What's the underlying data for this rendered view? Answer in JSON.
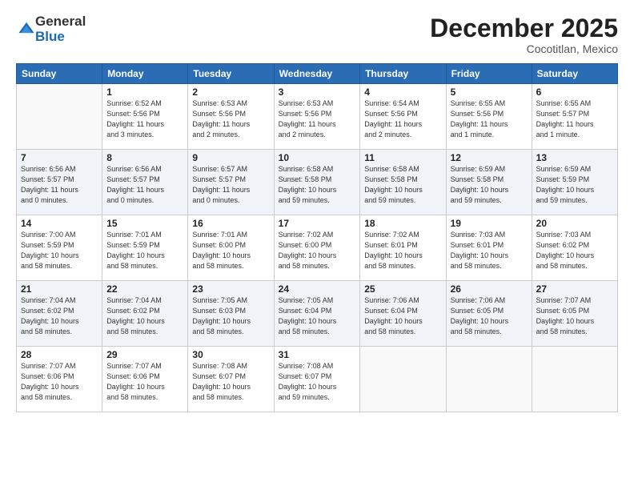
{
  "logo": {
    "general": "General",
    "blue": "Blue"
  },
  "title": "December 2025",
  "subtitle": "Cocotitlan, Mexico",
  "days_header": [
    "Sunday",
    "Monday",
    "Tuesday",
    "Wednesday",
    "Thursday",
    "Friday",
    "Saturday"
  ],
  "weeks": [
    [
      {
        "day": "",
        "info": ""
      },
      {
        "day": "1",
        "info": "Sunrise: 6:52 AM\nSunset: 5:56 PM\nDaylight: 11 hours\nand 3 minutes."
      },
      {
        "day": "2",
        "info": "Sunrise: 6:53 AM\nSunset: 5:56 PM\nDaylight: 11 hours\nand 2 minutes."
      },
      {
        "day": "3",
        "info": "Sunrise: 6:53 AM\nSunset: 5:56 PM\nDaylight: 11 hours\nand 2 minutes."
      },
      {
        "day": "4",
        "info": "Sunrise: 6:54 AM\nSunset: 5:56 PM\nDaylight: 11 hours\nand 2 minutes."
      },
      {
        "day": "5",
        "info": "Sunrise: 6:55 AM\nSunset: 5:56 PM\nDaylight: 11 hours\nand 1 minute."
      },
      {
        "day": "6",
        "info": "Sunrise: 6:55 AM\nSunset: 5:57 PM\nDaylight: 11 hours\nand 1 minute."
      }
    ],
    [
      {
        "day": "7",
        "info": "Sunrise: 6:56 AM\nSunset: 5:57 PM\nDaylight: 11 hours\nand 0 minutes."
      },
      {
        "day": "8",
        "info": "Sunrise: 6:56 AM\nSunset: 5:57 PM\nDaylight: 11 hours\nand 0 minutes."
      },
      {
        "day": "9",
        "info": "Sunrise: 6:57 AM\nSunset: 5:57 PM\nDaylight: 11 hours\nand 0 minutes."
      },
      {
        "day": "10",
        "info": "Sunrise: 6:58 AM\nSunset: 5:58 PM\nDaylight: 10 hours\nand 59 minutes."
      },
      {
        "day": "11",
        "info": "Sunrise: 6:58 AM\nSunset: 5:58 PM\nDaylight: 10 hours\nand 59 minutes."
      },
      {
        "day": "12",
        "info": "Sunrise: 6:59 AM\nSunset: 5:58 PM\nDaylight: 10 hours\nand 59 minutes."
      },
      {
        "day": "13",
        "info": "Sunrise: 6:59 AM\nSunset: 5:59 PM\nDaylight: 10 hours\nand 59 minutes."
      }
    ],
    [
      {
        "day": "14",
        "info": "Sunrise: 7:00 AM\nSunset: 5:59 PM\nDaylight: 10 hours\nand 58 minutes."
      },
      {
        "day": "15",
        "info": "Sunrise: 7:01 AM\nSunset: 5:59 PM\nDaylight: 10 hours\nand 58 minutes."
      },
      {
        "day": "16",
        "info": "Sunrise: 7:01 AM\nSunset: 6:00 PM\nDaylight: 10 hours\nand 58 minutes."
      },
      {
        "day": "17",
        "info": "Sunrise: 7:02 AM\nSunset: 6:00 PM\nDaylight: 10 hours\nand 58 minutes."
      },
      {
        "day": "18",
        "info": "Sunrise: 7:02 AM\nSunset: 6:01 PM\nDaylight: 10 hours\nand 58 minutes."
      },
      {
        "day": "19",
        "info": "Sunrise: 7:03 AM\nSunset: 6:01 PM\nDaylight: 10 hours\nand 58 minutes."
      },
      {
        "day": "20",
        "info": "Sunrise: 7:03 AM\nSunset: 6:02 PM\nDaylight: 10 hours\nand 58 minutes."
      }
    ],
    [
      {
        "day": "21",
        "info": "Sunrise: 7:04 AM\nSunset: 6:02 PM\nDaylight: 10 hours\nand 58 minutes."
      },
      {
        "day": "22",
        "info": "Sunrise: 7:04 AM\nSunset: 6:02 PM\nDaylight: 10 hours\nand 58 minutes."
      },
      {
        "day": "23",
        "info": "Sunrise: 7:05 AM\nSunset: 6:03 PM\nDaylight: 10 hours\nand 58 minutes."
      },
      {
        "day": "24",
        "info": "Sunrise: 7:05 AM\nSunset: 6:04 PM\nDaylight: 10 hours\nand 58 minutes."
      },
      {
        "day": "25",
        "info": "Sunrise: 7:06 AM\nSunset: 6:04 PM\nDaylight: 10 hours\nand 58 minutes."
      },
      {
        "day": "26",
        "info": "Sunrise: 7:06 AM\nSunset: 6:05 PM\nDaylight: 10 hours\nand 58 minutes."
      },
      {
        "day": "27",
        "info": "Sunrise: 7:07 AM\nSunset: 6:05 PM\nDaylight: 10 hours\nand 58 minutes."
      }
    ],
    [
      {
        "day": "28",
        "info": "Sunrise: 7:07 AM\nSunset: 6:06 PM\nDaylight: 10 hours\nand 58 minutes."
      },
      {
        "day": "29",
        "info": "Sunrise: 7:07 AM\nSunset: 6:06 PM\nDaylight: 10 hours\nand 58 minutes."
      },
      {
        "day": "30",
        "info": "Sunrise: 7:08 AM\nSunset: 6:07 PM\nDaylight: 10 hours\nand 58 minutes."
      },
      {
        "day": "31",
        "info": "Sunrise: 7:08 AM\nSunset: 6:07 PM\nDaylight: 10 hours\nand 59 minutes."
      },
      {
        "day": "",
        "info": ""
      },
      {
        "day": "",
        "info": ""
      },
      {
        "day": "",
        "info": ""
      }
    ]
  ]
}
